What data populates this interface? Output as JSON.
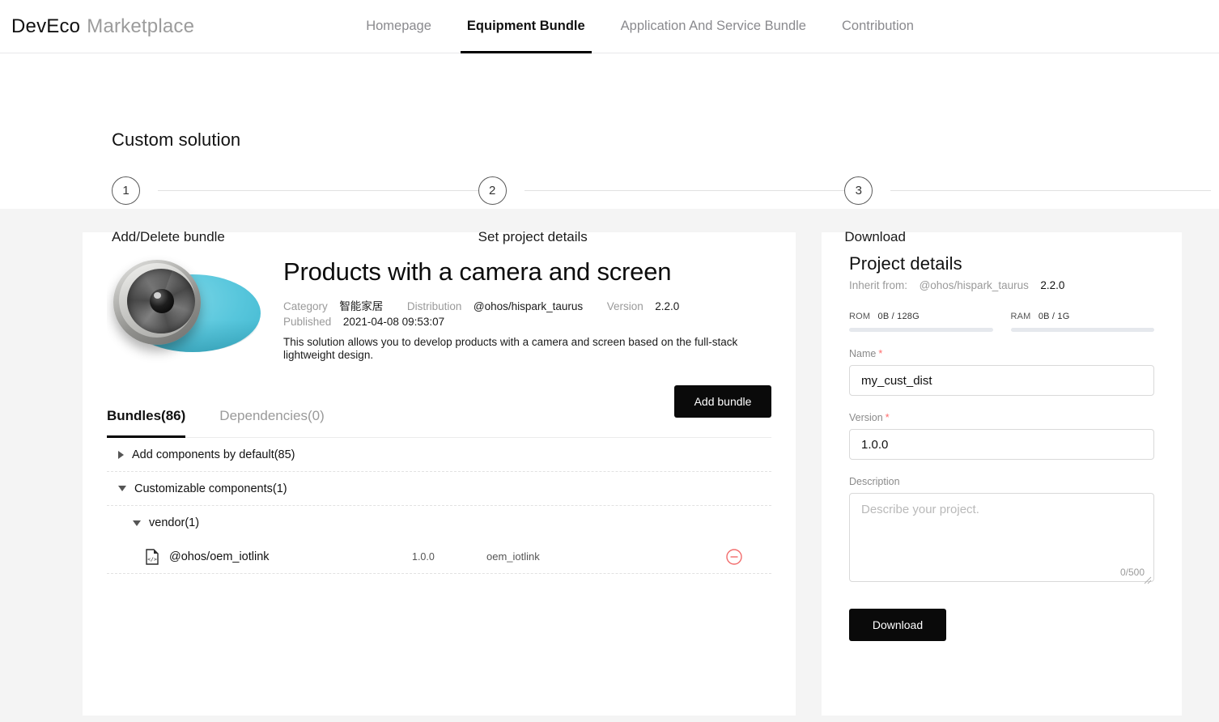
{
  "header": {
    "brand_primary": "DevEco",
    "brand_secondary": "Marketplace",
    "nav": [
      {
        "label": "Homepage",
        "active": false
      },
      {
        "label": "Equipment Bundle",
        "active": true
      },
      {
        "label": "Application And Service Bundle",
        "active": false
      },
      {
        "label": "Contribution",
        "active": false
      }
    ]
  },
  "stepper": {
    "title": "Custom solution",
    "steps": [
      {
        "number": "1",
        "label": "Add/Delete bundle"
      },
      {
        "number": "2",
        "label": "Set project details"
      },
      {
        "number": "3",
        "label": "Download"
      }
    ]
  },
  "product": {
    "title": "Products with a camera and screen",
    "category_label": "Category",
    "category_value": "智能家居",
    "distribution_label": "Distribution",
    "distribution_value": "@ohos/hispark_taurus",
    "version_label": "Version",
    "version_value": "2.2.0",
    "published_label": "Published",
    "published_value": "2021-04-08 09:53:07",
    "description": "This solution allows you to develop products with a camera and screen based on the full-stack lightweight design."
  },
  "bundles": {
    "tabs": [
      {
        "label": "Bundles(86)",
        "active": true
      },
      {
        "label": "Dependencies(0)",
        "active": false
      }
    ],
    "add_button": "Add bundle",
    "groups": [
      {
        "label": "Add components by default(85)",
        "expanded": false
      },
      {
        "label": "Customizable components(1)",
        "expanded": true
      }
    ],
    "vendor_group": {
      "label": "vendor(1)",
      "expanded": true
    },
    "items": [
      {
        "icon": "code-file-icon",
        "name": "@ohos/oem_iotlink",
        "version": "1.0.0",
        "alias": "oem_iotlink",
        "remove_icon": "minus-circle-icon"
      }
    ]
  },
  "project_details": {
    "title": "Project details",
    "inherit_label": "Inherit from:",
    "inherit_value": "@ohos/hispark_taurus",
    "inherit_version": "2.2.0",
    "rom": {
      "label": "ROM",
      "value": "0B / 128G",
      "percent": 0
    },
    "ram": {
      "label": "RAM",
      "value": "0B / 1G",
      "percent": 0
    },
    "name_label": "Name",
    "name_value": "my_cust_dist",
    "version_label": "Version",
    "version_value": "1.0.0",
    "description_label": "Description",
    "description_placeholder": "Describe your project.",
    "description_value": "",
    "counter": "0/500",
    "download_button": "Download"
  },
  "colors": {
    "accent": "#000000",
    "required": "#ff6b6b",
    "remove": "#f26d6d",
    "page_bg": "#f4f4f4"
  }
}
